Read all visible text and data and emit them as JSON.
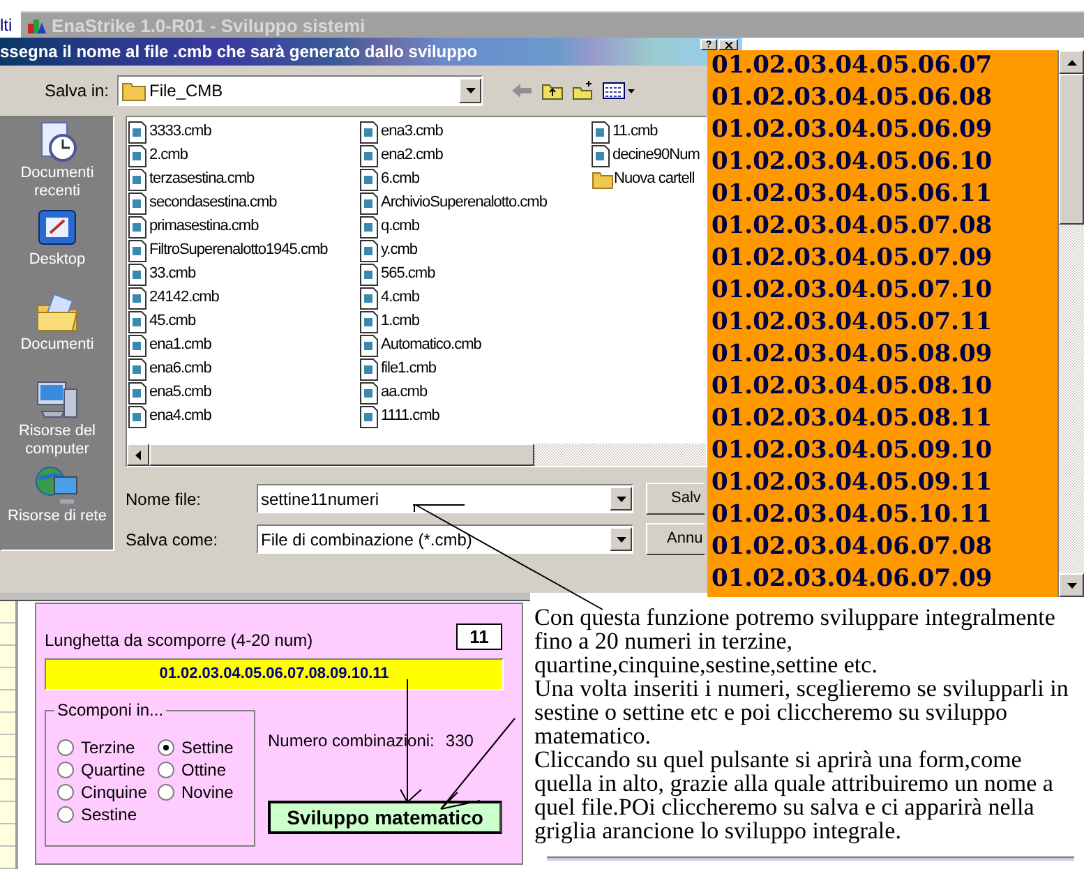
{
  "background_window": {
    "side_text": "lti",
    "title": "EnaStrike 1.0-R01 - Sviluppo sistemi"
  },
  "dialog": {
    "title": "ssegna il nome al file .cmb che sarà generato dallo sviluppo",
    "help_button": "?",
    "save_in_label": "Salva in:",
    "save_in_value": "File_CMB",
    "places": [
      {
        "kind": "recent",
        "label": "Documenti recenti"
      },
      {
        "kind": "desktop",
        "label": "Desktop"
      },
      {
        "kind": "documents",
        "label": "Documenti"
      },
      {
        "kind": "computer",
        "label": "Risorse del computer"
      },
      {
        "kind": "network",
        "label": "Risorse di rete"
      }
    ],
    "files": [
      {
        "kind": "file",
        "name": "3333.cmb"
      },
      {
        "kind": "file",
        "name": "2.cmb"
      },
      {
        "kind": "file",
        "name": "terzasestina.cmb"
      },
      {
        "kind": "file",
        "name": "secondasestina.cmb"
      },
      {
        "kind": "file",
        "name": "primasestina.cmb"
      },
      {
        "kind": "file",
        "name": "FiltroSuperenalotto1945.cmb"
      },
      {
        "kind": "file",
        "name": "33.cmb"
      },
      {
        "kind": "file",
        "name": "24142.cmb"
      },
      {
        "kind": "file",
        "name": "45.cmb"
      },
      {
        "kind": "file",
        "name": "ena1.cmb"
      },
      {
        "kind": "file",
        "name": "ena6.cmb"
      },
      {
        "kind": "file",
        "name": "ena5.cmb"
      },
      {
        "kind": "file",
        "name": "ena4.cmb"
      },
      {
        "kind": "file",
        "name": "ena3.cmb"
      },
      {
        "kind": "file",
        "name": "ena2.cmb"
      },
      {
        "kind": "file",
        "name": "6.cmb"
      },
      {
        "kind": "file",
        "name": "ArchivioSuperenalotto.cmb"
      },
      {
        "kind": "file",
        "name": "q.cmb"
      },
      {
        "kind": "file",
        "name": "y.cmb"
      },
      {
        "kind": "file",
        "name": "565.cmb"
      },
      {
        "kind": "file",
        "name": "4.cmb"
      },
      {
        "kind": "file",
        "name": "1.cmb"
      },
      {
        "kind": "file",
        "name": "Automatico.cmb"
      },
      {
        "kind": "file",
        "name": "file1.cmb"
      },
      {
        "kind": "file",
        "name": "aa.cmb"
      },
      {
        "kind": "file",
        "name": "1111.cmb"
      },
      {
        "kind": "file",
        "name": "11.cmb"
      },
      {
        "kind": "file",
        "name": "decine90Num"
      },
      {
        "kind": "folder",
        "name": "Nuova cartell"
      }
    ],
    "file_name_label": "Nome file:",
    "file_name_value": "settine11numeri",
    "save_as_label": "Salva come:",
    "save_as_value": "File di combinazione (*.cmb)",
    "save_button": "Salv",
    "cancel_button": "Annu"
  },
  "result_list": [
    "01.02.03.04.05.06.07",
    "01.02.03.04.05.06.08",
    "01.02.03.04.05.06.09",
    "01.02.03.04.05.06.10",
    "01.02.03.04.05.06.11",
    "01.02.03.04.05.07.08",
    "01.02.03.04.05.07.09",
    "01.02.03.04.05.07.10",
    "01.02.03.04.05.07.11",
    "01.02.03.04.05.08.09",
    "01.02.03.04.05.08.10",
    "01.02.03.04.05.08.11",
    "01.02.03.04.05.09.10",
    "01.02.03.04.05.09.11",
    "01.02.03.04.05.10.11",
    "01.02.03.04.06.07.08",
    "01.02.03.04.06.07.09"
  ],
  "form": {
    "length_label": "Lunghetta da scomporre (4-20 num)",
    "count": "11",
    "numbers": "01.02.03.04.05.06.07.08.09.10.11",
    "group_label": "Scomponi in...",
    "options": [
      {
        "label": "Terzine",
        "selected": false
      },
      {
        "label": "Quartine",
        "selected": false
      },
      {
        "label": "Cinquine",
        "selected": false
      },
      {
        "label": "Sestine",
        "selected": false
      },
      {
        "label": "Settine",
        "selected": true
      },
      {
        "label": "Ottine",
        "selected": false
      },
      {
        "label": "Novine",
        "selected": false
      }
    ],
    "combinations_label": "Numero combinazioni:",
    "combinations_value": "330",
    "button": "Sviluppo matematico"
  },
  "description": [
    "Con questa funzione potremo sviluppare integralmente fino a 20 numeri in terzine, quartine,cinquine,sestine,settine etc.",
    "Una volta inseriti i numeri, sceglieremo se svilupparli in sestine o settine etc e poi cliccheremo su sviluppo matematico.",
    "Cliccando su quel pulsante si aprirà una form,come quella in alto, grazie alla quale attribuiremo un nome a quel file.POi cliccheremo su salva e ci apparirà nella griglia arancione lo sviluppo integrale."
  ]
}
